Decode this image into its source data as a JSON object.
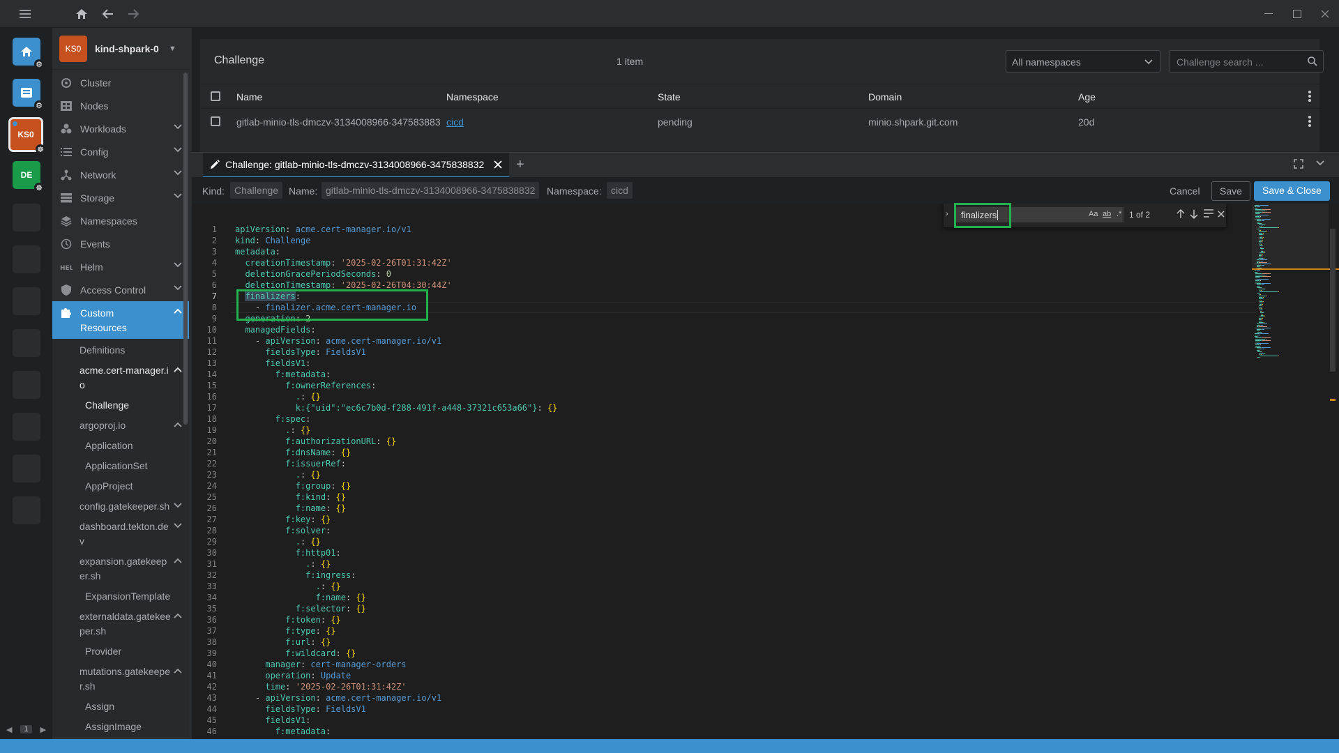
{
  "cluster": {
    "avatar": "KS0",
    "name": "kind-shpark-0"
  },
  "hotbar": {
    "items": [
      {
        "kind": "home",
        "icon": "home-icon"
      },
      {
        "kind": "catalog",
        "icon": "catalog-icon"
      },
      {
        "kind": "cluster",
        "label": "KS0",
        "color": "#c7501f"
      },
      {
        "kind": "cluster",
        "label": "DE",
        "color": "#1a9b4a"
      }
    ],
    "page": "1"
  },
  "sidebar": {
    "items": [
      {
        "label": "Cluster",
        "icon": "cluster-icon",
        "expandable": false
      },
      {
        "label": "Nodes",
        "icon": "nodes-icon",
        "expandable": false
      },
      {
        "label": "Workloads",
        "icon": "workloads-icon",
        "expandable": true
      },
      {
        "label": "Config",
        "icon": "config-icon",
        "expandable": true
      },
      {
        "label": "Network",
        "icon": "network-icon",
        "expandable": true
      },
      {
        "label": "Storage",
        "icon": "storage-icon",
        "expandable": true
      },
      {
        "label": "Namespaces",
        "icon": "namespaces-icon",
        "expandable": false
      },
      {
        "label": "Events",
        "icon": "events-icon",
        "expandable": false
      },
      {
        "label": "Helm",
        "icon": "helm-icon",
        "expandable": true
      },
      {
        "label": "Access Control",
        "icon": "access-control-icon",
        "expandable": true
      }
    ],
    "active": {
      "label_line1": "Custom",
      "label_line2": "Resources",
      "icon": "puzzle-icon"
    },
    "sub": [
      {
        "label": "Definitions",
        "level": 1,
        "expanded": null
      },
      {
        "label": "acme.cert-manager.io",
        "level": 1,
        "expanded": true,
        "bright": true
      },
      {
        "label": "Challenge",
        "level": 2,
        "selected": true
      },
      {
        "label": "argoproj.io",
        "level": 1,
        "expanded": true
      },
      {
        "label": "Application",
        "level": 2
      },
      {
        "label": "ApplicationSet",
        "level": 2
      },
      {
        "label": "AppProject",
        "level": 2
      },
      {
        "label": "config.gatekeeper.sh",
        "level": 1,
        "expanded": false
      },
      {
        "label": "dashboard.tekton.dev",
        "level": 1,
        "expanded": false
      },
      {
        "label": "expansion.gatekeeper.sh",
        "level": 1,
        "expanded": true
      },
      {
        "label": "ExpansionTemplate",
        "level": 2
      },
      {
        "label": "externaldata.gatekeeper.sh",
        "level": 1,
        "expanded": true
      },
      {
        "label": "Provider",
        "level": 2
      },
      {
        "label": "mutations.gatekeeper.sh",
        "level": 1,
        "expanded": true
      },
      {
        "label": "Assign",
        "level": 2
      },
      {
        "label": "AssignImage",
        "level": 2
      }
    ]
  },
  "list": {
    "title": "Challenge",
    "count": "1 item",
    "namespace_select": "All namespaces",
    "search_placeholder": "Challenge search ...",
    "columns": [
      "Name",
      "Namespace",
      "State",
      "Domain",
      "Age"
    ],
    "rows": [
      {
        "name": "gitlab-minio-tls-dmczv-3134008966-347583883",
        "namespace": "cicd",
        "state": "pending",
        "domain": "minio.shpark.git.com",
        "age": "20d"
      }
    ]
  },
  "dock": {
    "tab_label": "Challenge: gitlab-minio-tls-dmczv-3134008966-3475838832",
    "kind_label": "Kind:",
    "kind_value": "Challenge",
    "name_label": "Name:",
    "name_value": "gitlab-minio-tls-dmczv-3134008966-3475838832",
    "namespace_label": "Namespace:",
    "namespace_value": "cicd",
    "cancel": "Cancel",
    "save": "Save",
    "save_close": "Save & Close"
  },
  "find": {
    "query": "finalizers",
    "match_case": "Aa",
    "whole_word": "ab",
    "regex": ".*",
    "count": "1 of 2"
  },
  "code_lines": [
    [
      [
        "k",
        "apiVersion"
      ],
      [
        "p",
        ": "
      ],
      [
        "v",
        "acme.cert-manager.io/v1"
      ]
    ],
    [
      [
        "k",
        "kind"
      ],
      [
        "p",
        ": "
      ],
      [
        "v",
        "Challenge"
      ]
    ],
    [
      [
        "k",
        "metadata"
      ],
      [
        "p",
        ":"
      ]
    ],
    [
      [
        "p",
        "  "
      ],
      [
        "k",
        "creationTimestamp"
      ],
      [
        "p",
        ": "
      ],
      [
        "s",
        "'2025-02-26T01:31:42Z'"
      ]
    ],
    [
      [
        "p",
        "  "
      ],
      [
        "k",
        "deletionGracePeriodSeconds"
      ],
      [
        "p",
        ": "
      ],
      [
        "n",
        "0"
      ]
    ],
    [
      [
        "p",
        "  "
      ],
      [
        "k",
        "deletionTimestamp"
      ],
      [
        "p",
        ": "
      ],
      [
        "s",
        "'2025-02-26T04:30:44Z'"
      ]
    ],
    [
      [
        "p",
        "  "
      ],
      [
        "h",
        "finalizers"
      ],
      [
        "p",
        ":"
      ]
    ],
    [
      [
        "p",
        "    - "
      ],
      [
        "v",
        "finalizer.acme.cert-manager.io"
      ]
    ],
    [
      [
        "p",
        "  "
      ],
      [
        "k",
        "generation"
      ],
      [
        "p",
        ": "
      ],
      [
        "n",
        "2"
      ]
    ],
    [
      [
        "p",
        "  "
      ],
      [
        "k",
        "managedFields"
      ],
      [
        "p",
        ":"
      ]
    ],
    [
      [
        "p",
        "    - "
      ],
      [
        "k",
        "apiVersion"
      ],
      [
        "p",
        ": "
      ],
      [
        "v",
        "acme.cert-manager.io/v1"
      ]
    ],
    [
      [
        "p",
        "      "
      ],
      [
        "k",
        "fieldsType"
      ],
      [
        "p",
        ": "
      ],
      [
        "v",
        "FieldsV1"
      ]
    ],
    [
      [
        "p",
        "      "
      ],
      [
        "k",
        "fieldsV1"
      ],
      [
        "p",
        ":"
      ]
    ],
    [
      [
        "p",
        "        "
      ],
      [
        "k",
        "f:metadata"
      ],
      [
        "p",
        ":"
      ]
    ],
    [
      [
        "p",
        "          "
      ],
      [
        "k",
        "f:ownerReferences"
      ],
      [
        "p",
        ":"
      ]
    ],
    [
      [
        "p",
        "            "
      ],
      [
        "k",
        "."
      ],
      [
        "p",
        ": "
      ],
      [
        "b",
        "{}"
      ]
    ],
    [
      [
        "p",
        "            "
      ],
      [
        "k",
        "k:{\"uid\":\"ec6c7b0d-f288-491f-a448-37321c653a66\"}"
      ],
      [
        "p",
        ": "
      ],
      [
        "b",
        "{}"
      ]
    ],
    [
      [
        "p",
        "        "
      ],
      [
        "k",
        "f:spec"
      ],
      [
        "p",
        ":"
      ]
    ],
    [
      [
        "p",
        "          "
      ],
      [
        "k",
        "."
      ],
      [
        "p",
        ": "
      ],
      [
        "b",
        "{}"
      ]
    ],
    [
      [
        "p",
        "          "
      ],
      [
        "k",
        "f:authorizationURL"
      ],
      [
        "p",
        ": "
      ],
      [
        "b",
        "{}"
      ]
    ],
    [
      [
        "p",
        "          "
      ],
      [
        "k",
        "f:dnsName"
      ],
      [
        "p",
        ": "
      ],
      [
        "b",
        "{}"
      ]
    ],
    [
      [
        "p",
        "          "
      ],
      [
        "k",
        "f:issuerRef"
      ],
      [
        "p",
        ":"
      ]
    ],
    [
      [
        "p",
        "            "
      ],
      [
        "k",
        "."
      ],
      [
        "p",
        ": "
      ],
      [
        "b",
        "{}"
      ]
    ],
    [
      [
        "p",
        "            "
      ],
      [
        "k",
        "f:group"
      ],
      [
        "p",
        ": "
      ],
      [
        "b",
        "{}"
      ]
    ],
    [
      [
        "p",
        "            "
      ],
      [
        "k",
        "f:kind"
      ],
      [
        "p",
        ": "
      ],
      [
        "b",
        "{}"
      ]
    ],
    [
      [
        "p",
        "            "
      ],
      [
        "k",
        "f:name"
      ],
      [
        "p",
        ": "
      ],
      [
        "b",
        "{}"
      ]
    ],
    [
      [
        "p",
        "          "
      ],
      [
        "k",
        "f:key"
      ],
      [
        "p",
        ": "
      ],
      [
        "b",
        "{}"
      ]
    ],
    [
      [
        "p",
        "          "
      ],
      [
        "k",
        "f:solver"
      ],
      [
        "p",
        ":"
      ]
    ],
    [
      [
        "p",
        "            "
      ],
      [
        "k",
        "."
      ],
      [
        "p",
        ": "
      ],
      [
        "b",
        "{}"
      ]
    ],
    [
      [
        "p",
        "            "
      ],
      [
        "k",
        "f:http01"
      ],
      [
        "p",
        ":"
      ]
    ],
    [
      [
        "p",
        "              "
      ],
      [
        "k",
        "."
      ],
      [
        "p",
        ": "
      ],
      [
        "b",
        "{}"
      ]
    ],
    [
      [
        "p",
        "              "
      ],
      [
        "k",
        "f:ingress"
      ],
      [
        "p",
        ":"
      ]
    ],
    [
      [
        "p",
        "                "
      ],
      [
        "k",
        "."
      ],
      [
        "p",
        ": "
      ],
      [
        "b",
        "{}"
      ]
    ],
    [
      [
        "p",
        "                "
      ],
      [
        "k",
        "f:name"
      ],
      [
        "p",
        ": "
      ],
      [
        "b",
        "{}"
      ]
    ],
    [
      [
        "p",
        "            "
      ],
      [
        "k",
        "f:selector"
      ],
      [
        "p",
        ": "
      ],
      [
        "b",
        "{}"
      ]
    ],
    [
      [
        "p",
        "          "
      ],
      [
        "k",
        "f:token"
      ],
      [
        "p",
        ": "
      ],
      [
        "b",
        "{}"
      ]
    ],
    [
      [
        "p",
        "          "
      ],
      [
        "k",
        "f:type"
      ],
      [
        "p",
        ": "
      ],
      [
        "b",
        "{}"
      ]
    ],
    [
      [
        "p",
        "          "
      ],
      [
        "k",
        "f:url"
      ],
      [
        "p",
        ": "
      ],
      [
        "b",
        "{}"
      ]
    ],
    [
      [
        "p",
        "          "
      ],
      [
        "k",
        "f:wildcard"
      ],
      [
        "p",
        ": "
      ],
      [
        "b",
        "{}"
      ]
    ],
    [
      [
        "p",
        "      "
      ],
      [
        "k",
        "manager"
      ],
      [
        "p",
        ": "
      ],
      [
        "v",
        "cert-manager-orders"
      ]
    ],
    [
      [
        "p",
        "      "
      ],
      [
        "k",
        "operation"
      ],
      [
        "p",
        ": "
      ],
      [
        "v",
        "Update"
      ]
    ],
    [
      [
        "p",
        "      "
      ],
      [
        "k",
        "time"
      ],
      [
        "p",
        ": "
      ],
      [
        "s",
        "'2025-02-26T01:31:42Z'"
      ]
    ],
    [
      [
        "p",
        "    - "
      ],
      [
        "k",
        "apiVersion"
      ],
      [
        "p",
        ": "
      ],
      [
        "v",
        "acme.cert-manager.io/v1"
      ]
    ],
    [
      [
        "p",
        "      "
      ],
      [
        "k",
        "fieldsType"
      ],
      [
        "p",
        ": "
      ],
      [
        "v",
        "FieldsV1"
      ]
    ],
    [
      [
        "p",
        "      "
      ],
      [
        "k",
        "fieldsV1"
      ],
      [
        "p",
        ":"
      ]
    ],
    [
      [
        "p",
        "        "
      ],
      [
        "k",
        "f:metadata"
      ],
      [
        "p",
        ":"
      ]
    ]
  ],
  "current_line": 7,
  "colors": {
    "accent": "#3d90ce",
    "annotation": "#22b14c",
    "ks0": "#c7501f",
    "de": "#1a9b4a"
  }
}
